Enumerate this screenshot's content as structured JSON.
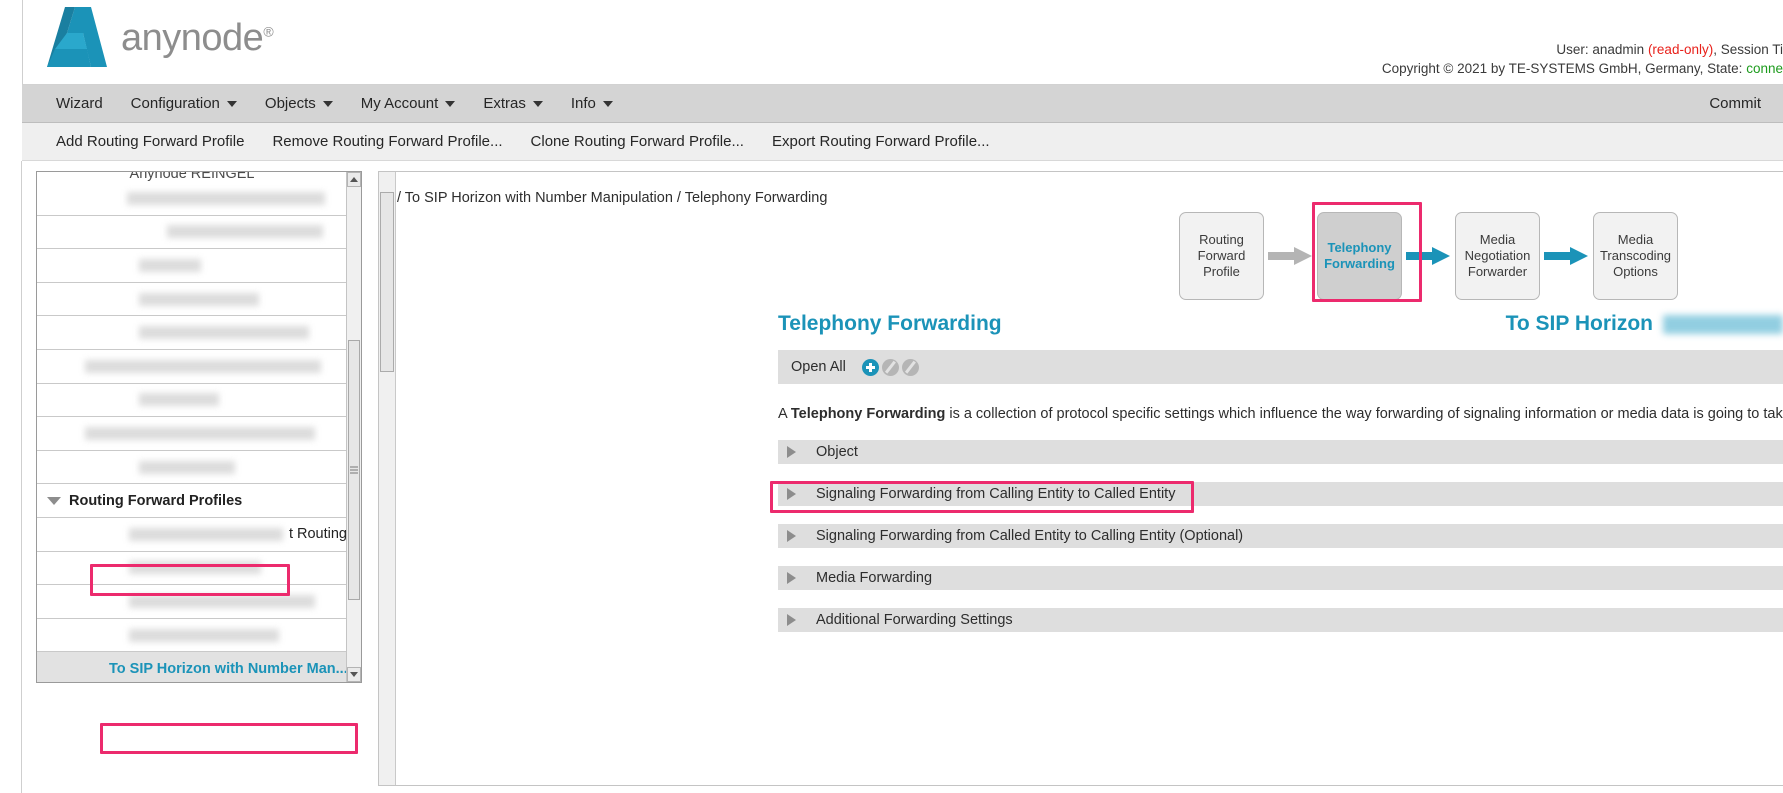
{
  "brand": {
    "logo_text": "anynode",
    "registered_mark": "®",
    "logo_icon": "anynode-a-logo-icon"
  },
  "header": {
    "user_prefix": "User: anadmin ",
    "user_readonly": "(read-only)",
    "user_suffix": ", Session Ti",
    "copyright_prefix": "Copyright © 2021 by TE-SYSTEMS GmbH, Germany, State: ",
    "state_value": "conne"
  },
  "menubar": {
    "items": [
      {
        "label": "Wizard",
        "has_caret": false
      },
      {
        "label": "Configuration",
        "has_caret": true
      },
      {
        "label": "Objects",
        "has_caret": true
      },
      {
        "label": "My Account",
        "has_caret": true
      },
      {
        "label": "Extras",
        "has_caret": true
      },
      {
        "label": "Info",
        "has_caret": true
      }
    ],
    "commit_label": "Commit"
  },
  "actionbar": {
    "items": [
      "Add Routing Forward Profile",
      "Remove Routing Forward Profile...",
      "Clone Routing Forward Profile...",
      "Export Routing Forward Profile..."
    ]
  },
  "sidebar": {
    "tree_title": "Anynode REINGEL",
    "group_label": "Routing Forward Profiles",
    "partial_row_label": "t Routing",
    "selected_item": "To SIP Horizon with Number Man...",
    "group_toggle_icon": "triangle-down-icon"
  },
  "main": {
    "breadcrumb": "/ To SIP Horizon with Number Manipulation / Telephony Forwarding",
    "flow_nodes": [
      {
        "label": "Routing\nForward\nProfile",
        "active": false
      },
      {
        "label": "Telephony\nForwarding",
        "active": true
      },
      {
        "label": "Media\nNegotiation\nForwarder",
        "active": false
      },
      {
        "label": "Media\nTranscoding\nOptions",
        "active": false
      }
    ],
    "flow_arrows": [
      "gray-arrow-icon",
      "teal-arrow-icon",
      "teal-arrow-icon"
    ],
    "page_title": "Telephony Forwarding",
    "profile_title": "To SIP Horizon",
    "toolbar": {
      "open_all_label": "Open All",
      "icons": [
        "add-circle-icon",
        "disabled-circle-icon",
        "disabled-circle-icon"
      ]
    },
    "description": {
      "prefix": "A ",
      "bold": "Telephony Forwarding",
      "suffix": " is a collection of protocol specific settings which influence the way forwarding of signaling information or media data is going to take place."
    },
    "sections": [
      {
        "label": "Object",
        "highlighted": false
      },
      {
        "label": "Signaling Forwarding from Calling Entity to Called Entity",
        "highlighted": true
      },
      {
        "label": "Signaling Forwarding from Called Entity to Calling Entity (Optional)",
        "highlighted": false
      },
      {
        "label": "Media Forwarding",
        "highlighted": false
      },
      {
        "label": "Additional Forwarding Settings",
        "highlighted": false
      }
    ]
  },
  "colors": {
    "accent_teal": "#1b93b8",
    "highlight_pink": "#ec2a6d",
    "readonly_red": "#e8211b",
    "state_green": "#1d9b1d"
  }
}
